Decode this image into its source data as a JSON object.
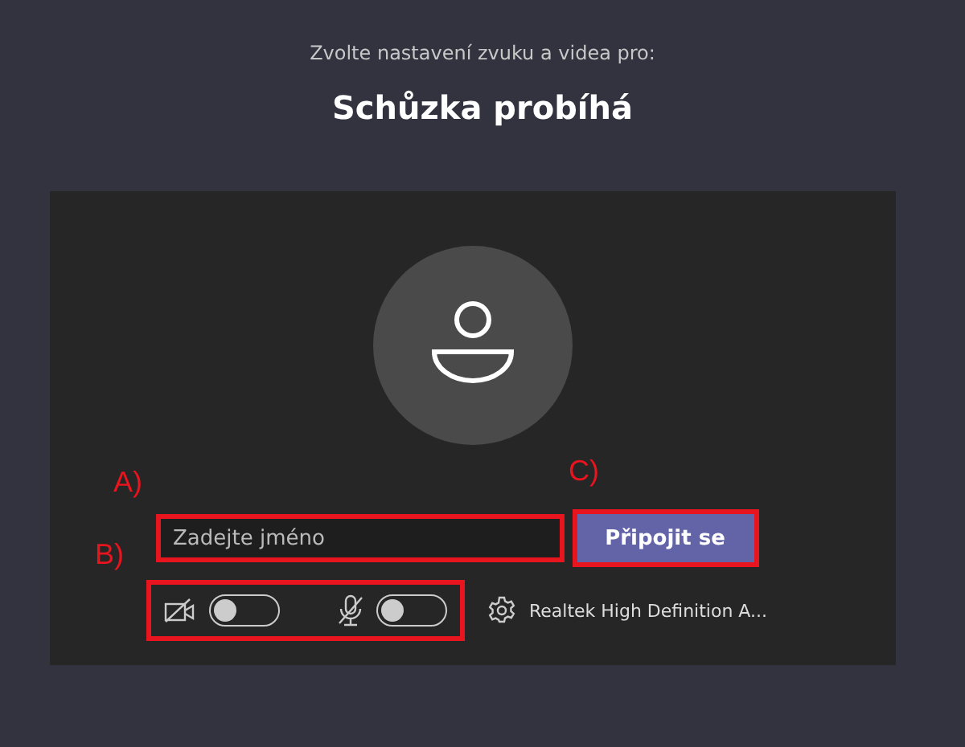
{
  "subtitle": "Zvolte nastavení zvuku a videa pro:",
  "title": "Schůzka probíhá",
  "name_field": {
    "placeholder": "Zadejte jméno"
  },
  "join_button": "Připojit se",
  "toggles": [
    {
      "kind": "camera",
      "on": false
    },
    {
      "kind": "microphone",
      "on": false
    }
  ],
  "audio_device": "Realtek High Definition A...",
  "annotations": [
    {
      "label": "A)"
    },
    {
      "label": "B)"
    },
    {
      "label": "C)"
    }
  ]
}
